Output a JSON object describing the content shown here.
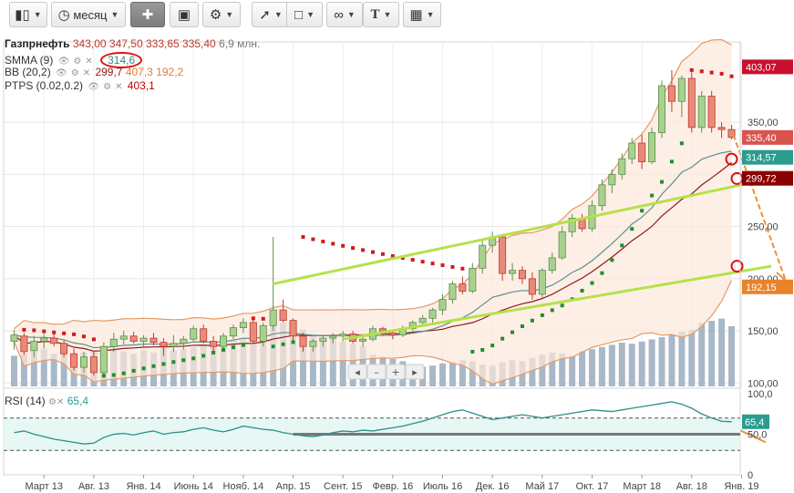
{
  "toolbar": {
    "interval_label": "месяц",
    "text_tool_label": "T"
  },
  "instrument": {
    "name": "Газпрнефть",
    "open": "343,00",
    "high": "347,50",
    "low": "333,65",
    "close": "335,40",
    "volume": "6,9 млн."
  },
  "indicators": [
    {
      "name": "SMMA (9)",
      "values": [
        "314,6"
      ],
      "colors": [
        "#2e8b8b"
      ]
    },
    {
      "name": "BB (20,2)",
      "values": [
        "299,7",
        "407,3",
        "192,2"
      ],
      "colors": [
        "#8b1a1a",
        "#e07b39",
        "#e07b39"
      ]
    },
    {
      "name": "PTPS (0.02,0.2)",
      "values": [
        "403,1"
      ],
      "colors": [
        "#c00000"
      ]
    }
  ],
  "rsi": {
    "name": "RSI (14)",
    "value": "65,4"
  },
  "nav": {
    "prev": "◂",
    "minus": "–",
    "plus": "+",
    "next": "▸"
  },
  "price_tags": [
    {
      "text": "403,07",
      "value": 403.07,
      "color": "#c8102e"
    },
    {
      "text": "335,40",
      "value": 335.4,
      "color": "#d9534f"
    },
    {
      "text": "314,57",
      "value": 314.57,
      "color": "#2a9d8f"
    },
    {
      "text": "299,72",
      "value": 299.72,
      "color": "#8b0000"
    },
    {
      "text": "192,15",
      "value": 192.15,
      "color": "#e8832a"
    }
  ],
  "rsi_tag": {
    "text": "65,4",
    "value": 65.4,
    "color": "#2a9d8f"
  },
  "chart_data": {
    "type": "candlestick",
    "price_axis": {
      "min": 95,
      "max": 420,
      "ticks": [
        100,
        150,
        200,
        250,
        300,
        350
      ],
      "tick_labels": [
        "100,00",
        "150,00",
        "200,00",
        "250,00",
        "300,00",
        "350,00"
      ]
    },
    "rsi_axis": {
      "min": 0,
      "max": 100,
      "ticks": [
        0,
        50,
        100
      ],
      "tick_labels": [
        "0",
        "50,0",
        "100,0"
      ],
      "levels": [
        30,
        70
      ]
    },
    "x_labels": [
      "Март 13",
      "Авг. 13",
      "Янв. 14",
      "Июнь 14",
      "Нояб. 14",
      "Апр. 15",
      "Сент. 15",
      "Февр. 16",
      "Июль 16",
      "Дек. 16",
      "Май 17",
      "Окт. 17",
      "Март 18",
      "Авг. 18",
      "Янв. 19"
    ],
    "x_label_index": [
      3,
      8,
      13,
      18,
      23,
      28,
      33,
      38,
      43,
      48,
      53,
      58,
      63,
      68,
      73
    ],
    "candles": [
      {
        "o": 140,
        "h": 151,
        "l": 132,
        "c": 146
      },
      {
        "o": 145,
        "h": 148,
        "l": 127,
        "c": 130
      },
      {
        "o": 131,
        "h": 145,
        "l": 125,
        "c": 140
      },
      {
        "o": 140,
        "h": 147,
        "l": 133,
        "c": 143
      },
      {
        "o": 143,
        "h": 148,
        "l": 135,
        "c": 138
      },
      {
        "o": 138,
        "h": 141,
        "l": 125,
        "c": 128
      },
      {
        "o": 128,
        "h": 133,
        "l": 112,
        "c": 115
      },
      {
        "o": 115,
        "h": 130,
        "l": 110,
        "c": 125
      },
      {
        "o": 125,
        "h": 131,
        "l": 107,
        "c": 110
      },
      {
        "o": 110,
        "h": 139,
        "l": 105,
        "c": 135
      },
      {
        "o": 135,
        "h": 148,
        "l": 130,
        "c": 142
      },
      {
        "o": 142,
        "h": 150,
        "l": 137,
        "c": 145
      },
      {
        "o": 145,
        "h": 149,
        "l": 138,
        "c": 140
      },
      {
        "o": 140,
        "h": 146,
        "l": 134,
        "c": 143
      },
      {
        "o": 143,
        "h": 148,
        "l": 136,
        "c": 139
      },
      {
        "o": 139,
        "h": 143,
        "l": 126,
        "c": 135
      },
      {
        "o": 135,
        "h": 146,
        "l": 130,
        "c": 138
      },
      {
        "o": 138,
        "h": 145,
        "l": 132,
        "c": 142
      },
      {
        "o": 142,
        "h": 155,
        "l": 140,
        "c": 152
      },
      {
        "o": 152,
        "h": 156,
        "l": 138,
        "c": 140
      },
      {
        "o": 140,
        "h": 145,
        "l": 130,
        "c": 135
      },
      {
        "o": 135,
        "h": 148,
        "l": 132,
        "c": 145
      },
      {
        "o": 145,
        "h": 156,
        "l": 142,
        "c": 153
      },
      {
        "o": 153,
        "h": 162,
        "l": 148,
        "c": 158
      },
      {
        "o": 158,
        "h": 162,
        "l": 138,
        "c": 140
      },
      {
        "o": 140,
        "h": 158,
        "l": 135,
        "c": 155
      },
      {
        "o": 155,
        "h": 240,
        "l": 150,
        "c": 170
      },
      {
        "o": 170,
        "h": 180,
        "l": 158,
        "c": 160
      },
      {
        "o": 160,
        "h": 162,
        "l": 140,
        "c": 145
      },
      {
        "o": 145,
        "h": 148,
        "l": 130,
        "c": 135
      },
      {
        "o": 135,
        "h": 142,
        "l": 130,
        "c": 140
      },
      {
        "o": 140,
        "h": 146,
        "l": 135,
        "c": 143
      },
      {
        "o": 143,
        "h": 148,
        "l": 138,
        "c": 145
      },
      {
        "o": 145,
        "h": 150,
        "l": 140,
        "c": 147
      },
      {
        "o": 147,
        "h": 150,
        "l": 138,
        "c": 140
      },
      {
        "o": 140,
        "h": 145,
        "l": 135,
        "c": 142
      },
      {
        "o": 142,
        "h": 155,
        "l": 140,
        "c": 152
      },
      {
        "o": 152,
        "h": 154,
        "l": 145,
        "c": 148
      },
      {
        "o": 148,
        "h": 150,
        "l": 142,
        "c": 146
      },
      {
        "o": 146,
        "h": 155,
        "l": 144,
        "c": 152
      },
      {
        "o": 152,
        "h": 160,
        "l": 150,
        "c": 158
      },
      {
        "o": 158,
        "h": 165,
        "l": 154,
        "c": 162
      },
      {
        "o": 162,
        "h": 172,
        "l": 158,
        "c": 170
      },
      {
        "o": 170,
        "h": 185,
        "l": 165,
        "c": 180
      },
      {
        "o": 180,
        "h": 198,
        "l": 176,
        "c": 195
      },
      {
        "o": 195,
        "h": 202,
        "l": 185,
        "c": 188
      },
      {
        "o": 188,
        "h": 215,
        "l": 186,
        "c": 210
      },
      {
        "o": 210,
        "h": 238,
        "l": 205,
        "c": 232
      },
      {
        "o": 232,
        "h": 245,
        "l": 225,
        "c": 240
      },
      {
        "o": 240,
        "h": 242,
        "l": 198,
        "c": 205
      },
      {
        "o": 205,
        "h": 215,
        "l": 198,
        "c": 208
      },
      {
        "o": 208,
        "h": 212,
        "l": 195,
        "c": 200
      },
      {
        "o": 200,
        "h": 206,
        "l": 180,
        "c": 185
      },
      {
        "o": 185,
        "h": 210,
        "l": 182,
        "c": 208
      },
      {
        "o": 208,
        "h": 225,
        "l": 205,
        "c": 220
      },
      {
        "o": 220,
        "h": 250,
        "l": 218,
        "c": 245
      },
      {
        "o": 245,
        "h": 262,
        "l": 240,
        "c": 258
      },
      {
        "o": 258,
        "h": 262,
        "l": 245,
        "c": 248
      },
      {
        "o": 248,
        "h": 275,
        "l": 245,
        "c": 270
      },
      {
        "o": 270,
        "h": 295,
        "l": 265,
        "c": 290
      },
      {
        "o": 290,
        "h": 305,
        "l": 282,
        "c": 300
      },
      {
        "o": 300,
        "h": 320,
        "l": 295,
        "c": 315
      },
      {
        "o": 315,
        "h": 335,
        "l": 310,
        "c": 330
      },
      {
        "o": 330,
        "h": 338,
        "l": 305,
        "c": 312
      },
      {
        "o": 312,
        "h": 345,
        "l": 310,
        "c": 340
      },
      {
        "o": 340,
        "h": 390,
        "l": 335,
        "c": 385
      },
      {
        "o": 385,
        "h": 400,
        "l": 360,
        "c": 370
      },
      {
        "o": 370,
        "h": 395,
        "l": 355,
        "c": 392
      },
      {
        "o": 392,
        "h": 398,
        "l": 340,
        "c": 345
      },
      {
        "o": 345,
        "h": 380,
        "l": 340,
        "c": 375
      },
      {
        "o": 375,
        "h": 380,
        "l": 340,
        "c": 345
      },
      {
        "o": 345,
        "h": 350,
        "l": 335,
        "c": 343
      },
      {
        "o": 343,
        "h": 347.5,
        "l": 333.65,
        "c": 335.4
      }
    ],
    "volume": [
      28,
      30,
      32,
      34,
      30,
      33,
      29,
      31,
      33,
      36,
      34,
      32,
      30,
      33,
      31,
      35,
      33,
      34,
      36,
      38,
      37,
      39,
      42,
      44,
      40,
      50,
      70,
      58,
      54,
      52,
      46,
      42,
      44,
      41,
      39,
      37,
      29,
      27,
      25,
      23,
      20,
      18,
      19,
      21,
      22,
      24,
      23,
      20,
      19,
      22,
      24,
      23,
      26,
      29,
      31,
      30,
      28,
      32,
      34,
      36,
      38,
      40,
      39,
      41,
      43,
      45,
      47,
      50,
      52,
      58,
      60,
      62,
      55
    ],
    "rsi": [
      52,
      54,
      50,
      47,
      44,
      42,
      40,
      38,
      39,
      46,
      50,
      51,
      49,
      52,
      54,
      50,
      52,
      53,
      56,
      58,
      55,
      53,
      56,
      60,
      58,
      56,
      55,
      52,
      50,
      48,
      47,
      49,
      52,
      54,
      53,
      55,
      54,
      56,
      58,
      60,
      63,
      66,
      70,
      74,
      78,
      80,
      76,
      72,
      68,
      70,
      72,
      74,
      72,
      70,
      72,
      74,
      76,
      78,
      80,
      79,
      78,
      80,
      82,
      84,
      86,
      88,
      90,
      87,
      82,
      75,
      70,
      66,
      65.4
    ],
    "annotations": {
      "green_lines": [
        {
          "from_index": 26,
          "from": 195,
          "to_index": 76,
          "to": 296
        },
        {
          "from_index": 33,
          "from": 142,
          "to_index": 76,
          "to": 212
        }
      ],
      "rsi_level_line": 50
    }
  }
}
